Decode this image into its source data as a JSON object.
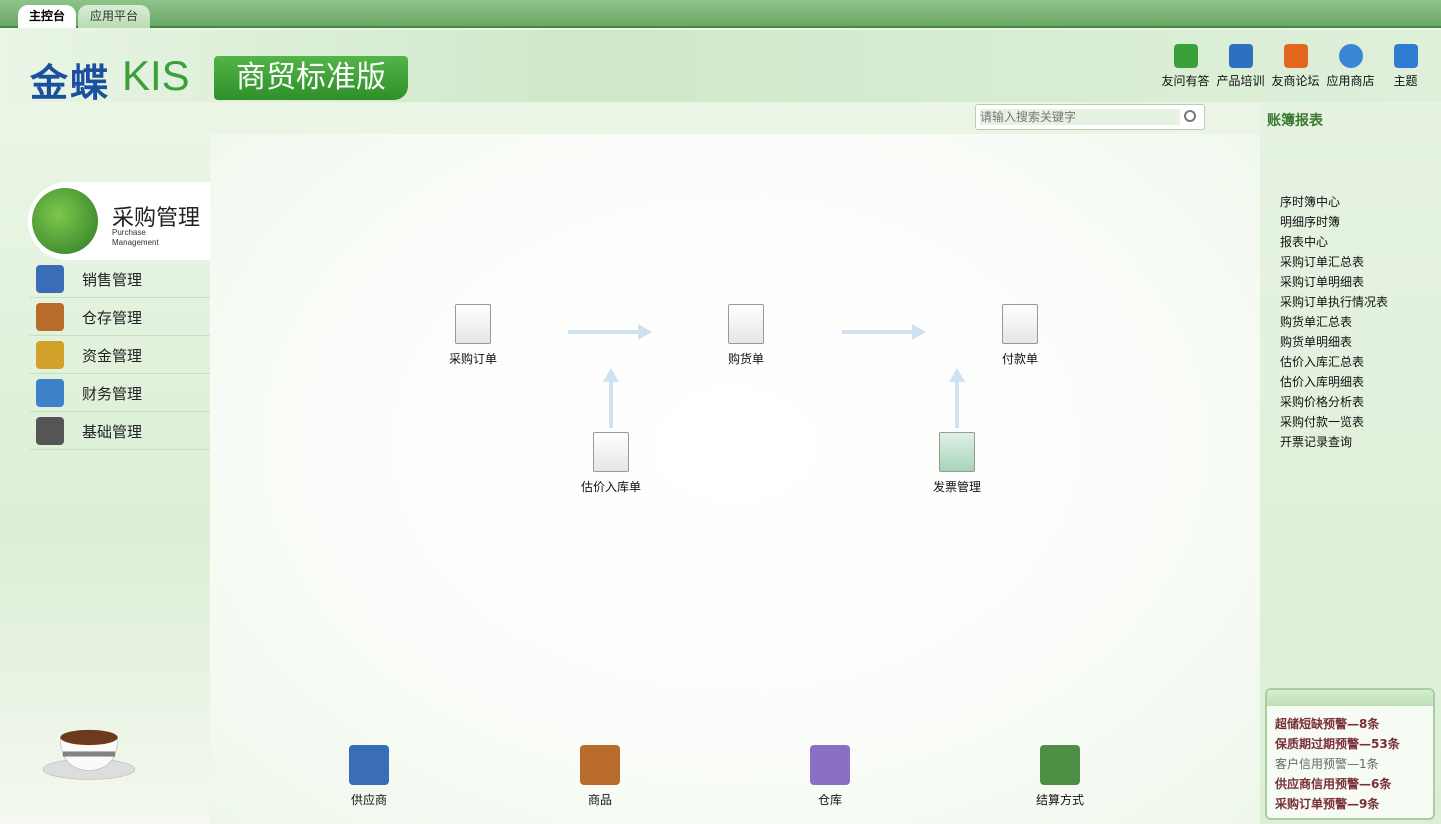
{
  "tabs": [
    {
      "label": "主控台"
    },
    {
      "label": "应用平台"
    }
  ],
  "brand": {
    "name_cn": "金蝶",
    "name_en": "KIS",
    "edition": "商贸标准版"
  },
  "toolbar": [
    {
      "label": "友问有答",
      "icon": "qa-icon",
      "color": "#3aa03a"
    },
    {
      "label": "产品培训",
      "icon": "training-icon",
      "color": "#2d6fc1"
    },
    {
      "label": "友商论坛",
      "icon": "forum-icon",
      "color": "#e2681f"
    },
    {
      "label": "应用商店",
      "icon": "app-store-icon",
      "color": "#3a86d4"
    },
    {
      "label": "主题",
      "icon": "theme-icon",
      "color": "#2f7bd1"
    }
  ],
  "search": {
    "placeholder": "请输入搜索关键字"
  },
  "nav": {
    "active": {
      "title": "采购管理",
      "subtitle_line1": "Purchase",
      "subtitle_line2": "Management"
    },
    "items": [
      {
        "label": "销售管理",
        "icon": "sales-icon",
        "color": "#3a6db8"
      },
      {
        "label": "仓存管理",
        "icon": "warehouse-icon",
        "color": "#b86b2a"
      },
      {
        "label": "资金管理",
        "icon": "money-icon",
        "color": "#d1a12a"
      },
      {
        "label": "财务管理",
        "icon": "finance-icon",
        "color": "#3d82c9"
      },
      {
        "label": "基础管理",
        "icon": "tools-icon",
        "color": "#555555"
      }
    ]
  },
  "flow": [
    {
      "label": "采购订单"
    },
    {
      "label": "购货单"
    },
    {
      "label": "付款单"
    },
    {
      "label": "估价入库单"
    },
    {
      "label": "发票管理"
    }
  ],
  "bottom": [
    {
      "label": "供应商",
      "color": "#3a6db8"
    },
    {
      "label": "商品",
      "color": "#b86b2a"
    },
    {
      "label": "仓库",
      "color": "#8a6fc4"
    },
    {
      "label": "结算方式",
      "color": "#4f8f45"
    }
  ],
  "reports": {
    "title": "账簿报表",
    "items": [
      "序时簿中心",
      "明细序时簿",
      "报表中心",
      "采购订单汇总表",
      "采购订单明细表",
      "采购订单执行情况表",
      "购货单汇总表",
      "购货单明细表",
      "估价入库汇总表",
      "估价入库明细表",
      "采购价格分析表",
      "采购付款一览表",
      "开票记录查询"
    ]
  },
  "alerts": [
    {
      "text": "超储短缺预警—8条",
      "bold": true
    },
    {
      "text": "保质期过期预警—53条",
      "bold": true
    },
    {
      "text": "客户信用预警—1条",
      "bold": false
    },
    {
      "text": "供应商信用预警—6条",
      "bold": true
    },
    {
      "text": "采购订单预警—9条",
      "bold": true
    }
  ]
}
